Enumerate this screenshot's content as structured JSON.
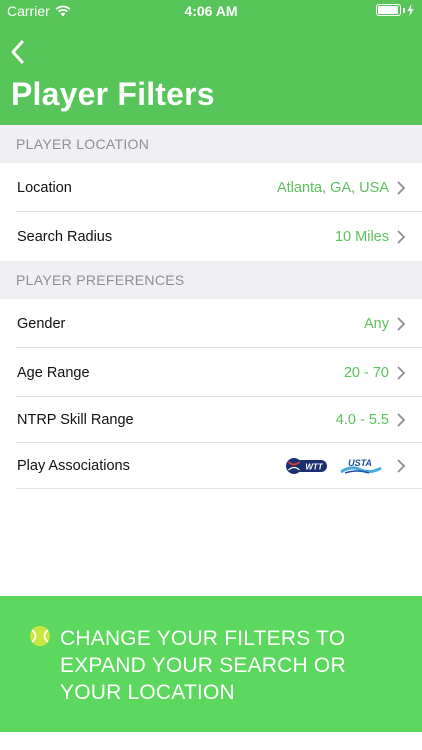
{
  "status_bar": {
    "carrier": "Carrier",
    "time": "4:06 AM",
    "battery_level": 0.95
  },
  "header": {
    "title": "Player Filters"
  },
  "sections": {
    "location": {
      "title": "PLAYER LOCATION",
      "location": {
        "label": "Location",
        "value": "Atlanta, GA, USA"
      },
      "radius": {
        "label": "Search Radius",
        "value": "10 Miles"
      }
    },
    "preferences": {
      "title": "PLAYER PREFERENCES",
      "gender": {
        "label": "Gender",
        "value": "Any"
      },
      "age": {
        "label": "Age Range",
        "value": "20 - 70"
      },
      "ntrp": {
        "label": "NTRP Skill Range",
        "value": "4.0 - 5.5"
      },
      "associations": {
        "label": "Play Associations",
        "logos": [
          "WTT",
          "USTA"
        ]
      }
    }
  },
  "footer": {
    "message": "CHANGE YOUR FILTERS TO EXPAND YOUR SEARCH OR YOUR LOCATION"
  },
  "colors": {
    "accent": "#58c55a",
    "value_green": "#5cc15d",
    "banner": "#5cd85e"
  },
  "icons": [
    "wifi-icon",
    "battery-icon",
    "charging-icon",
    "back-chevron-icon",
    "chevron-right-icon",
    "tennis-ball-icon",
    "wtt-logo",
    "usta-logo"
  ]
}
